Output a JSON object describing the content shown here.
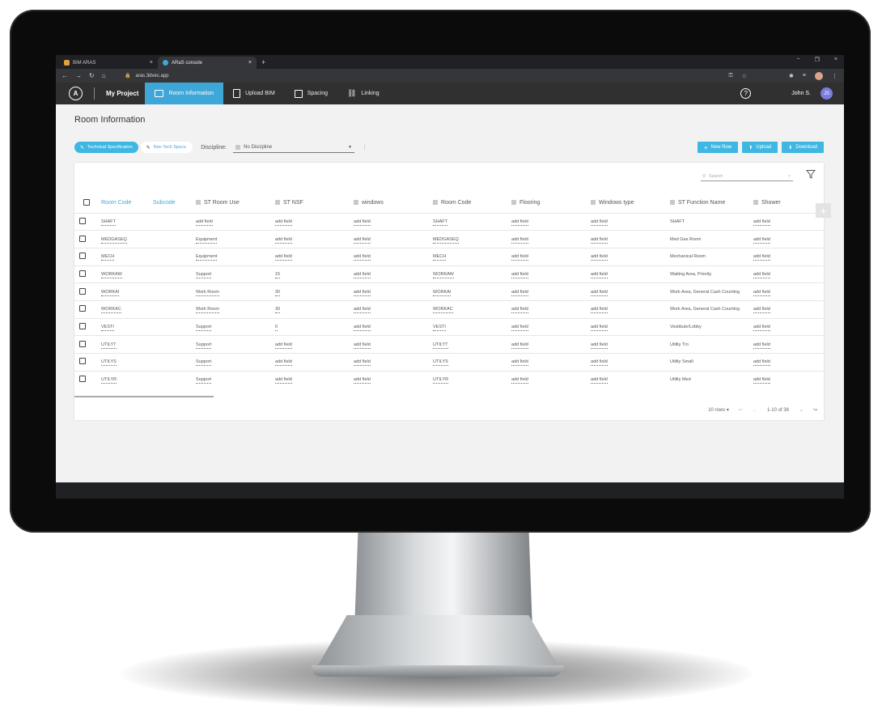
{
  "browser": {
    "tabs": [
      {
        "title": "BIM ARAS",
        "close": "×"
      },
      {
        "title": "ARaS console",
        "close": "×"
      }
    ],
    "new_tab": "+",
    "window_controls": [
      "−",
      "❐",
      "×"
    ],
    "url": "aras.3dvec.app"
  },
  "app": {
    "logo": "A",
    "project": "My Project",
    "nav": [
      "Room Information",
      "Upload BIM",
      "Spacing",
      "Linking"
    ],
    "user": "John S.",
    "user_initials": "JS",
    "accent": "#3fa7d8"
  },
  "page": {
    "title": "Room Information",
    "chips": [
      "Technical Specification",
      "Non Tech Specs."
    ],
    "discipline_label": "Discipline:",
    "discipline_value": "No Discipline",
    "buttons": {
      "new_row": "New Row",
      "upload": "Upload",
      "download": "Download"
    }
  },
  "table": {
    "search_placeholder": "Search",
    "columns": [
      "Room Code",
      "Subcode",
      "ST Room Use",
      "ST NSF",
      "windows",
      "Room Code",
      "Flooring",
      "Windows type",
      "ST Function Name",
      "Shower"
    ],
    "rows": [
      [
        "SHAFT",
        "",
        "add field",
        "add field",
        "add field",
        "SHAFT",
        "add field",
        "add field",
        "SHAFT",
        "add field"
      ],
      [
        "MEDGASEQ",
        "",
        "Equipment",
        "add field",
        "add field",
        "MEDGASEQ",
        "add field",
        "add field",
        "Med Gas Room",
        "add field"
      ],
      [
        "MECH",
        "",
        "Equipment",
        "add field",
        "add field",
        "MECH",
        "add field",
        "add field",
        "Mechanical Room",
        "add field"
      ],
      [
        "WORKAW",
        "",
        "Support",
        "15",
        "add field",
        "WORKAW",
        "add field",
        "add field",
        "Waiting Area, Priority",
        "add field"
      ],
      [
        "WORKAI",
        "",
        "Work Room",
        "30",
        "add field",
        "WORKAI",
        "add field",
        "add field",
        "Work Area, General Cash Counting",
        "add field"
      ],
      [
        "WORKAC",
        "",
        "Work Room",
        "30",
        "add field",
        "WORKAC",
        "add field",
        "add field",
        "Work Area, General Cash Counting",
        "add field"
      ],
      [
        "VESTI",
        "",
        "Support",
        "0",
        "add field",
        "VESTI",
        "add field",
        "add field",
        "Vestibule/Lobby",
        "add field"
      ],
      [
        "UTILYT",
        "",
        "Support",
        "add field",
        "add field",
        "UTILYT",
        "add field",
        "add field",
        "Utility Tro",
        "add field"
      ],
      [
        "UTILYS",
        "",
        "Support",
        "add field",
        "add field",
        "UTILYS",
        "add field",
        "add field",
        "Utility Small",
        "add field"
      ],
      [
        "UTILYR",
        "",
        "Support",
        "add field",
        "add field",
        "UTILYR",
        "add field",
        "add field",
        "Utility Med",
        "add field"
      ]
    ],
    "pagination": {
      "rows_per_page": "10 rows",
      "range": "1-10 of 38"
    }
  }
}
